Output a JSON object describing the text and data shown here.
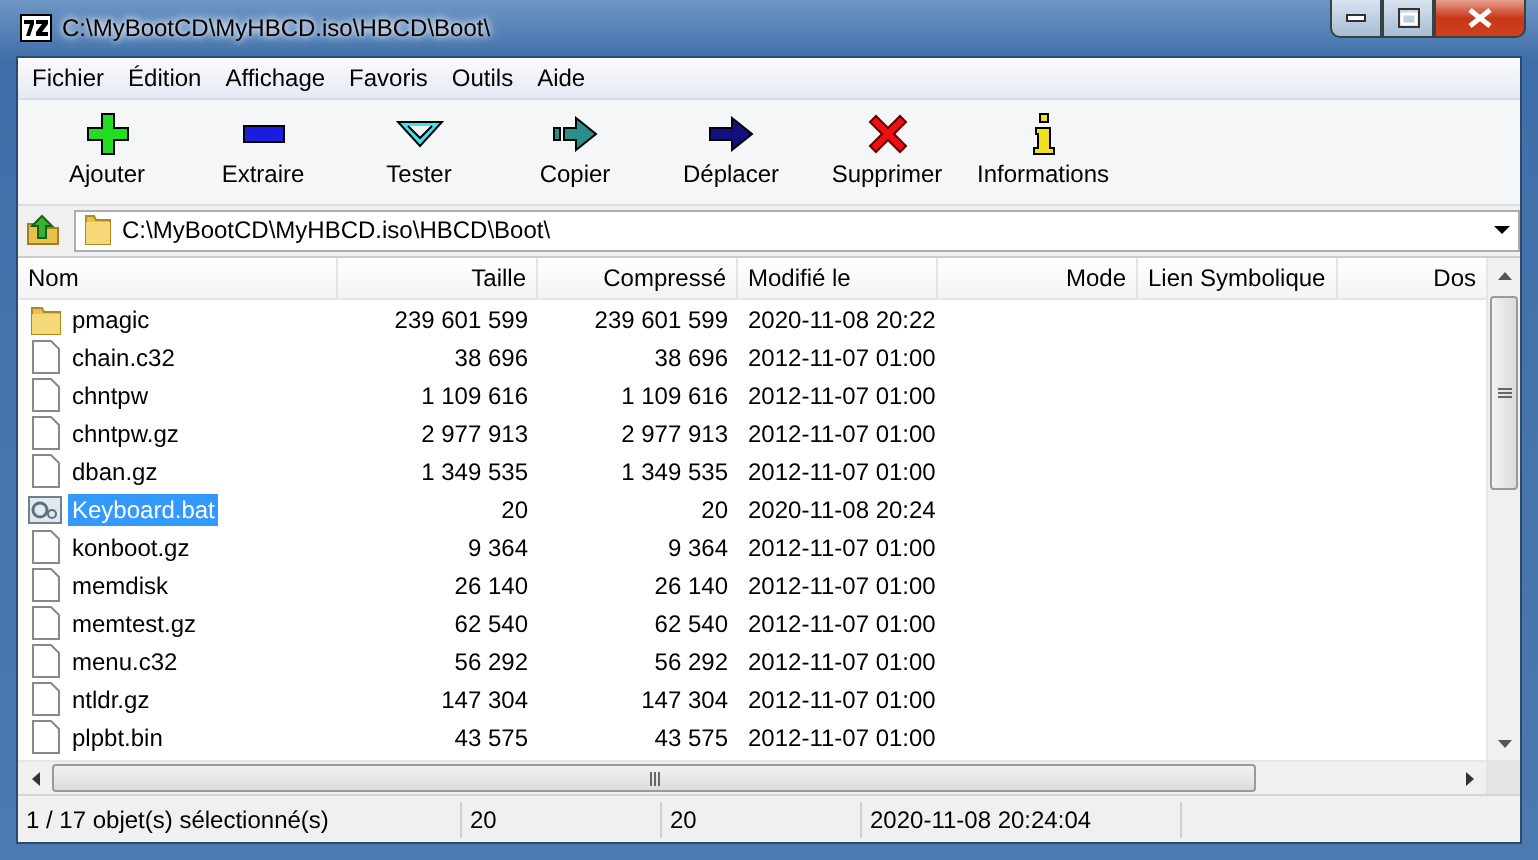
{
  "window": {
    "title": "C:\\MyBootCD\\MyHBCD.iso\\HBCD\\Boot\\"
  },
  "menu": [
    "Fichier",
    "Édition",
    "Affichage",
    "Favoris",
    "Outils",
    "Aide"
  ],
  "toolbar": [
    {
      "kind": "add",
      "label": "Ajouter"
    },
    {
      "kind": "extract",
      "label": "Extraire"
    },
    {
      "kind": "test",
      "label": "Tester"
    },
    {
      "kind": "copy",
      "label": "Copier"
    },
    {
      "kind": "move",
      "label": "Déplacer"
    },
    {
      "kind": "delete",
      "label": "Supprimer"
    },
    {
      "kind": "info",
      "label": "Informations"
    }
  ],
  "address": {
    "path": "C:\\MyBootCD\\MyHBCD.iso\\HBCD\\Boot\\"
  },
  "table": {
    "columns": [
      "Nom",
      "Taille",
      "Compressé",
      "Modifié le",
      "Mode",
      "Lien Symbolique",
      "Dos"
    ],
    "rows": [
      {
        "kind": "folder",
        "selected": false,
        "name": "pmagic",
        "size": "239 601 599",
        "packed": "239 601 599",
        "modified": "2020-11-08 20:22"
      },
      {
        "kind": "file",
        "selected": false,
        "name": "chain.c32",
        "size": "38 696",
        "packed": "38 696",
        "modified": "2012-11-07 01:00"
      },
      {
        "kind": "file",
        "selected": false,
        "name": "chntpw",
        "size": "1 109 616",
        "packed": "1 109 616",
        "modified": "2012-11-07 01:00"
      },
      {
        "kind": "file",
        "selected": false,
        "name": "chntpw.gz",
        "size": "2 977 913",
        "packed": "2 977 913",
        "modified": "2012-11-07 01:00"
      },
      {
        "kind": "file",
        "selected": false,
        "name": "dban.gz",
        "size": "1 349 535",
        "packed": "1 349 535",
        "modified": "2012-11-07 01:00"
      },
      {
        "kind": "script",
        "selected": true,
        "name": "Keyboard.bat",
        "size": "20",
        "packed": "20",
        "modified": "2020-11-08 20:24"
      },
      {
        "kind": "file",
        "selected": false,
        "name": "konboot.gz",
        "size": "9 364",
        "packed": "9 364",
        "modified": "2012-11-07 01:00"
      },
      {
        "kind": "file",
        "selected": false,
        "name": "memdisk",
        "size": "26 140",
        "packed": "26 140",
        "modified": "2012-11-07 01:00"
      },
      {
        "kind": "file",
        "selected": false,
        "name": "memtest.gz",
        "size": "62 540",
        "packed": "62 540",
        "modified": "2012-11-07 01:00"
      },
      {
        "kind": "file",
        "selected": false,
        "name": "menu.c32",
        "size": "56 292",
        "packed": "56 292",
        "modified": "2012-11-07 01:00"
      },
      {
        "kind": "file",
        "selected": false,
        "name": "ntldr.gz",
        "size": "147 304",
        "packed": "147 304",
        "modified": "2012-11-07 01:00"
      },
      {
        "kind": "file",
        "selected": false,
        "name": "plpbt.bin",
        "size": "43 575",
        "packed": "43 575",
        "modified": "2012-11-07 01:00"
      }
    ]
  },
  "status_bar": [
    "1 / 17 objet(s) sélectionné(s)",
    "20",
    "20",
    "2020-11-08 20:24:04"
  ]
}
